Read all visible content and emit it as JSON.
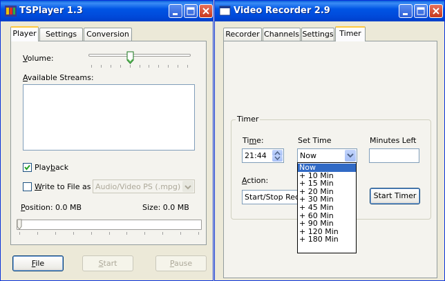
{
  "tsplayer": {
    "title": "TSPlayer 1.3",
    "tabs": [
      "Player",
      "Settings",
      "Conversion"
    ],
    "volume_label": "Volume:",
    "streams_label": "Available Streams:",
    "playback_label": "Playback",
    "playback_checked": true,
    "write_label": "Write to File as",
    "write_checked": false,
    "format_value": "Audio/Video PS  (.mpg)",
    "position_text": "Position: 0.0 MB",
    "size_text": "Size: 0.0 MB",
    "volume_level_percent": 40,
    "position_percent": 0,
    "buttons": {
      "file": "File",
      "start": "Start",
      "pause": "Pause"
    }
  },
  "recorder": {
    "title": "Video Recorder 2.9",
    "tabs": [
      "Recorder",
      "Channels",
      "Settings",
      "Timer"
    ],
    "group_title": "Timer",
    "time_label": "Time:",
    "time_value": "21:44",
    "set_time_label": "Set Time",
    "set_time_value": "Now",
    "minutes_left_label": "Minutes Left",
    "minutes_left_value": "",
    "action_label": "Action:",
    "action_value": "Start/Stop Recording",
    "start_timer_label": "Start Timer",
    "dropdown_options": [
      "Now",
      "+ 10 Min",
      "+ 15 Min",
      "+ 20 Min",
      "+ 30 Min",
      "+ 45 Min",
      "+ 60 Min",
      "+ 90 Min",
      "+ 120 Min",
      "+ 180 Min"
    ],
    "dropdown_selected": "Now"
  },
  "colors": {
    "titlebar_blue": "#0055E5",
    "close_red": "#C6381D",
    "selection_blue": "#316AC5",
    "checkbox_green": "#21A121"
  }
}
